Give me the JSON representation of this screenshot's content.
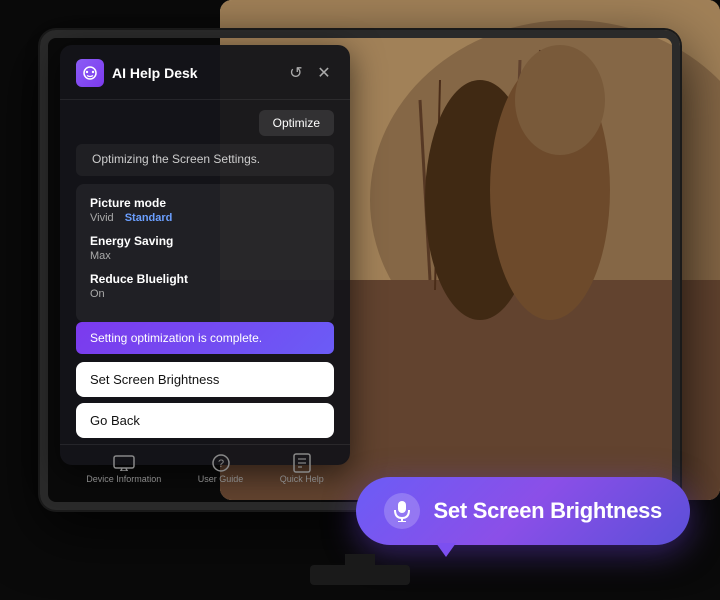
{
  "app": {
    "title": "AI Help Desk",
    "optimize_label": "Optimize",
    "status_text": "Optimizing the Screen Settings.",
    "reset_icon": "↺",
    "close_icon": "✕"
  },
  "settings": {
    "picture_mode": {
      "label": "Picture mode",
      "value_active": "Vivid",
      "value_selected": "Standard"
    },
    "energy_saving": {
      "label": "Energy Saving",
      "value": "Max"
    },
    "reduce_bluelight": {
      "label": "Reduce Bluelight",
      "value": "On"
    }
  },
  "optimization_complete": {
    "text": "Setting optimization is complete."
  },
  "actions": {
    "set_brightness_label": "Set Screen Brightness",
    "go_back_label": "Go Back"
  },
  "footer": {
    "items": [
      {
        "icon": "▬",
        "label": "Device Information"
      },
      {
        "icon": "?",
        "label": "User Guide"
      },
      {
        "icon": "▣",
        "label": "Quick Help"
      }
    ]
  },
  "voice_bubble": {
    "text": "Set Screen Brightness",
    "mic_icon": "🎤"
  },
  "colors": {
    "accent_purple": "#7C3AED",
    "accent_blue": "#6B9FFF",
    "bubble_gradient_start": "#6B5CF6",
    "bubble_gradient_end": "#8B4FE8"
  }
}
